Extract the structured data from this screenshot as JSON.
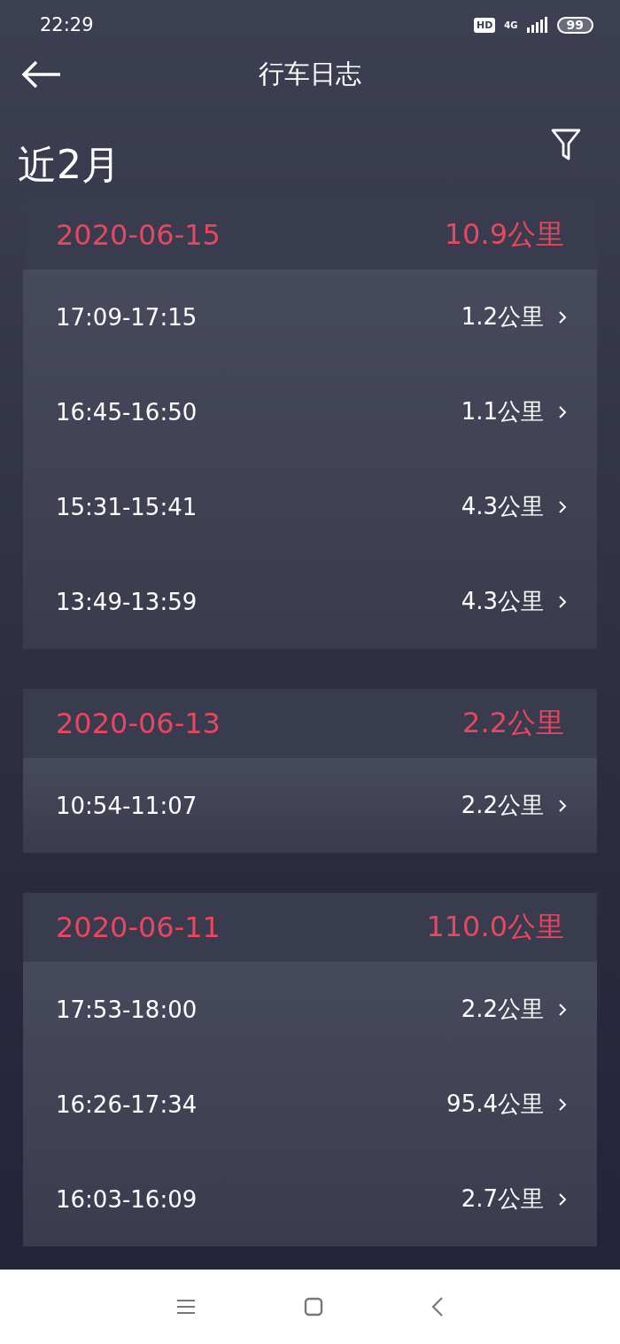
{
  "status_bar": {
    "time": "22:29",
    "hd": "HD",
    "network": "4G",
    "battery": "99"
  },
  "app_bar": {
    "title": "行车日志"
  },
  "period": "近2月",
  "days": [
    {
      "date": "2020-06-15",
      "total": "10.9公里",
      "trips": [
        {
          "time": "17:09-17:15",
          "distance": "1.2公里"
        },
        {
          "time": "16:45-16:50",
          "distance": "1.1公里"
        },
        {
          "time": "15:31-15:41",
          "distance": "4.3公里"
        },
        {
          "time": "13:49-13:59",
          "distance": "4.3公里"
        }
      ]
    },
    {
      "date": "2020-06-13",
      "total": "2.2公里",
      "trips": [
        {
          "time": "10:54-11:07",
          "distance": "2.2公里"
        }
      ]
    },
    {
      "date": "2020-06-11",
      "total": "110.0公里",
      "trips": [
        {
          "time": "17:53-18:00",
          "distance": "2.2公里"
        },
        {
          "time": "16:26-17:34",
          "distance": "95.4公里"
        },
        {
          "time": "16:03-16:09",
          "distance": "2.7公里"
        }
      ]
    }
  ]
}
